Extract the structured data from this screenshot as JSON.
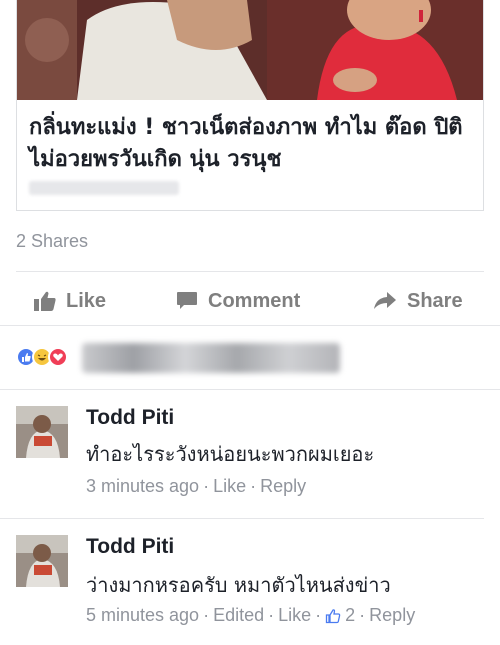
{
  "post": {
    "title": "กลิ่นทะแม่ง ! ชาวเน็ตส่องภาพ ทำไม ต๊อด ปิติ ไม่อวยพรวันเกิด นุ่น วรนุช",
    "shares": "2 Shares"
  },
  "actions": {
    "like": "Like",
    "comment": "Comment",
    "share": "Share"
  },
  "reactions": [
    "like-icon",
    "haha-icon",
    "love-icon"
  ],
  "comments": [
    {
      "author": "Todd Piti",
      "text": "ทำอะไรระวังหน่อยนะพวกผมเยอะ",
      "time": "3 minutes ago",
      "like": "Like",
      "reply": "Reply"
    },
    {
      "author": "Todd Piti",
      "text": "ว่างมากหรอครับ หมาตัวไหนส่งข่าว",
      "time": "5 minutes ago",
      "edited": "Edited",
      "like": "Like",
      "like_count": "2",
      "reply": "Reply"
    }
  ],
  "colors": {
    "muted": "#90949c",
    "action": "#7f7f7f",
    "accent": "#4a7bf0"
  }
}
